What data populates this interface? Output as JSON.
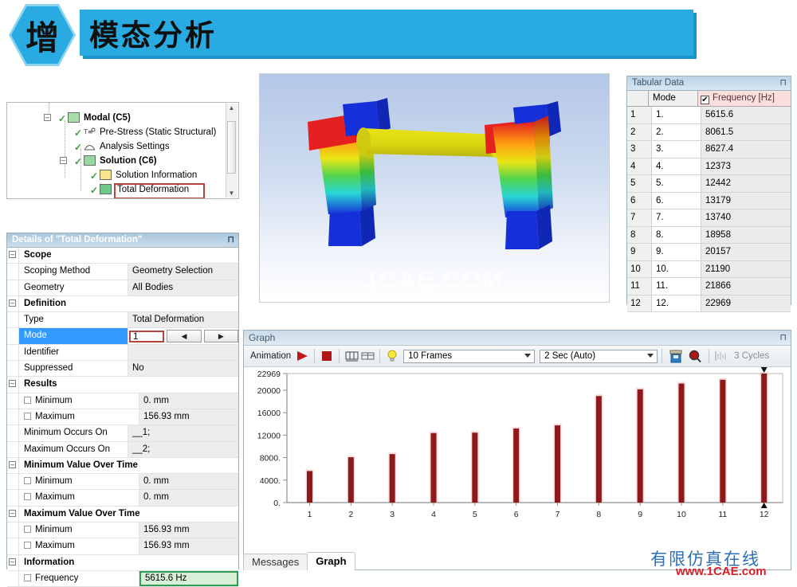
{
  "header": {
    "badge_char": "增",
    "title": "模态分析"
  },
  "tree": {
    "items": [
      {
        "label": "Modal (C5)",
        "icon": "modal-icon"
      },
      {
        "label": "Pre-Stress (Static Structural)",
        "icon": "prestress-icon"
      },
      {
        "label": "Analysis Settings",
        "icon": "analysis-settings-icon"
      },
      {
        "label": "Solution (C6)",
        "icon": "solution-icon"
      },
      {
        "label": "Solution Information",
        "icon": "solution-information-icon"
      },
      {
        "label": "Total Deformation",
        "icon": "total-deformation-icon"
      }
    ]
  },
  "details": {
    "title": "Details of \"Total Deformation\"",
    "pin": "⊓",
    "rows": [
      {
        "kind": "header",
        "name": "Scope"
      },
      {
        "kind": "prop",
        "name": "Scoping Method",
        "value": "Geometry Selection"
      },
      {
        "kind": "prop",
        "name": "Geometry",
        "value": "All Bodies"
      },
      {
        "kind": "header",
        "name": "Definition"
      },
      {
        "kind": "prop",
        "name": "Type",
        "value": "Total Deformation"
      },
      {
        "kind": "mode",
        "name": "Mode",
        "value": "1",
        "prev": "◀",
        "next": "▶"
      },
      {
        "kind": "prop",
        "name": "Identifier",
        "value": ""
      },
      {
        "kind": "prop",
        "name": "Suppressed",
        "value": "No"
      },
      {
        "kind": "header",
        "name": "Results"
      },
      {
        "kind": "check",
        "name": "Minimum",
        "value": "0. mm"
      },
      {
        "kind": "check",
        "name": "Maximum",
        "value": "156.93 mm"
      },
      {
        "kind": "prop",
        "name": "Minimum Occurs On",
        "value": "__1;"
      },
      {
        "kind": "prop",
        "name": "Maximum Occurs On",
        "value": "__2;"
      },
      {
        "kind": "header",
        "name": "Minimum Value Over Time"
      },
      {
        "kind": "check",
        "name": "Minimum",
        "value": "0. mm"
      },
      {
        "kind": "check",
        "name": "Maximum",
        "value": "0. mm"
      },
      {
        "kind": "header",
        "name": "Maximum Value Over Time"
      },
      {
        "kind": "check",
        "name": "Minimum",
        "value": "156.93 mm"
      },
      {
        "kind": "check",
        "name": "Maximum",
        "value": "156.93 mm"
      },
      {
        "kind": "header",
        "name": "Information"
      },
      {
        "kind": "freq",
        "name": "Frequency",
        "value": "5615.6 Hz"
      }
    ]
  },
  "viewport": {
    "watermark": "1CAE.COM"
  },
  "tabular": {
    "title": "Tabular Data",
    "pin": "⊓",
    "columns": [
      "",
      "Mode",
      "Frequency [Hz]"
    ],
    "frequency_checked": "✔",
    "rows": [
      {
        "index": "1",
        "mode": "1.",
        "frequency": "5615.6"
      },
      {
        "index": "2",
        "mode": "2.",
        "frequency": "8061.5"
      },
      {
        "index": "3",
        "mode": "3.",
        "frequency": "8627.4"
      },
      {
        "index": "4",
        "mode": "4.",
        "frequency": "12373"
      },
      {
        "index": "5",
        "mode": "5.",
        "frequency": "12442"
      },
      {
        "index": "6",
        "mode": "6.",
        "frequency": "13179"
      },
      {
        "index": "7",
        "mode": "7.",
        "frequency": "13740"
      },
      {
        "index": "8",
        "mode": "8.",
        "frequency": "18958"
      },
      {
        "index": "9",
        "mode": "9.",
        "frequency": "20157"
      },
      {
        "index": "10",
        "mode": "10.",
        "frequency": "21190"
      },
      {
        "index": "11",
        "mode": "11.",
        "frequency": "21866"
      },
      {
        "index": "12",
        "mode": "12.",
        "frequency": "22969"
      }
    ]
  },
  "graph": {
    "title": "Graph",
    "pin": "⊓",
    "toolbar": {
      "animation_label": "Animation",
      "play": "play-icon",
      "stop": "stop-icon",
      "distribute1": "distribute-columns-icon",
      "distribute2": "distribute-rows-icon",
      "bulb": "lightbulb-icon",
      "frames": "10 Frames",
      "duration": "2 Sec (Auto)",
      "export": "save-animation-icon",
      "zoom": "zoom-icon",
      "cycles_icon": "cycles-icon",
      "cycles": "3 Cycles"
    }
  },
  "chart_data": {
    "type": "bar",
    "title": "",
    "xlabel": "",
    "ylabel": "",
    "categories": [
      "1",
      "2",
      "3",
      "4",
      "5",
      "6",
      "7",
      "8",
      "9",
      "10",
      "11",
      "12"
    ],
    "values": [
      5615.6,
      8061.5,
      8627.4,
      12373,
      12442,
      13179,
      13740,
      18958,
      20157,
      21190,
      21866,
      22969
    ],
    "ylim": [
      0,
      22969
    ],
    "yticks": [
      "0.",
      "4000.",
      "8000.",
      "12000",
      "16000",
      "20000",
      "22969"
    ],
    "ytick_values": [
      0,
      4000,
      8000,
      12000,
      16000,
      20000,
      22969
    ],
    "xticks": [
      "1",
      "2",
      "3",
      "4",
      "5",
      "6",
      "7",
      "8",
      "9",
      "10",
      "11",
      "12"
    ],
    "grid": false,
    "legend": "none",
    "bar_color": "#8c1a1a",
    "selected_bar": "12",
    "selected_label": "12."
  },
  "bottom_tabs": [
    {
      "label": "Messages",
      "active": false
    },
    {
      "label": "Graph",
      "active": true
    }
  ],
  "logo": {
    "cn_text": "有限仿真在线",
    "url": "www.1CAE.com"
  }
}
